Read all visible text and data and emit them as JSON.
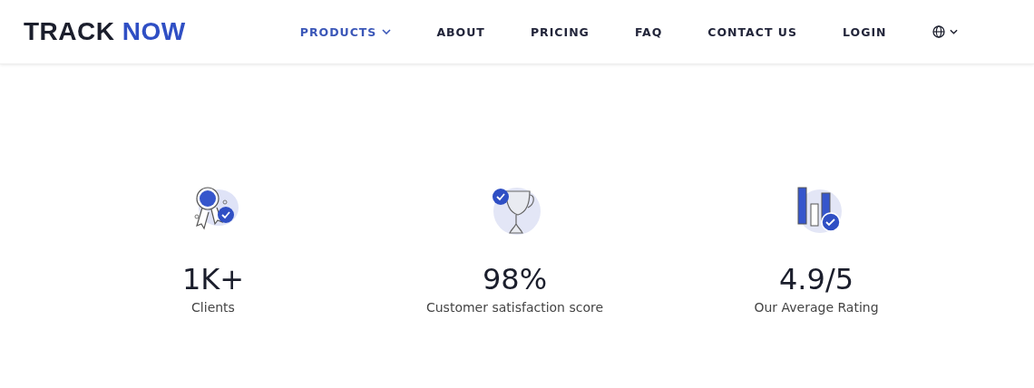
{
  "logo": {
    "first": "TRACK",
    "second": "NOW"
  },
  "nav": [
    {
      "label": "PRODUCTS",
      "selected": true,
      "dropdown": true
    },
    {
      "label": "ABOUT",
      "selected": false,
      "dropdown": false
    },
    {
      "label": "PRICING",
      "selected": false,
      "dropdown": false
    },
    {
      "label": "FAQ",
      "selected": false,
      "dropdown": false
    },
    {
      "label": "CONTACT US",
      "selected": false,
      "dropdown": false
    },
    {
      "label": "LOGIN",
      "selected": false,
      "dropdown": false
    }
  ],
  "stats": [
    {
      "kind": "award",
      "value": "1K+",
      "label": "Clients"
    },
    {
      "kind": "trophy",
      "value": "98%",
      "label": "Customer satisfaction score"
    },
    {
      "kind": "chart",
      "value": "4.9/5",
      "label": "Our Average Rating"
    }
  ]
}
